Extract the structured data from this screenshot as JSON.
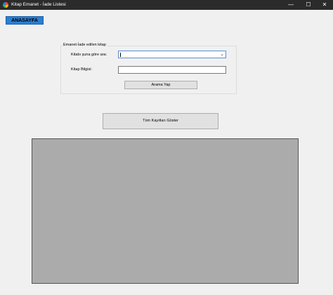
{
  "window": {
    "title": "Kitap Emanet - İade Listesi",
    "controls": {
      "minimize": "—",
      "maximize": "☐",
      "close": "✕"
    }
  },
  "toolbar": {
    "home_label": "ANASAYFA"
  },
  "search_group": {
    "title": "Emanet-İade edilen kitap",
    "search_by_label": "Kitabı şuna göre ara:",
    "search_by_value": "",
    "book_info_label": "Kitap Bilgisi:",
    "book_info_value": "",
    "search_button": "Arama Yap"
  },
  "show_all_button": "Tüm Kayıtları Göster",
  "colors": {
    "titlebar": "#2b2b2b",
    "home_button": "#2a7fd4",
    "grid_background": "#ababab",
    "window_background": "#f0f0f0"
  },
  "icons": {
    "app": "app-icon",
    "combo_arrow": "chevron-down-icon"
  }
}
